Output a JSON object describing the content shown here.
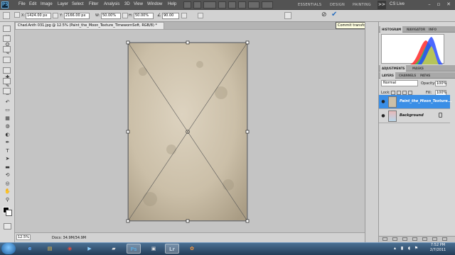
{
  "app": {
    "logo": "PS",
    "menu": [
      "File",
      "Edit",
      "Image",
      "Layer",
      "Select",
      "Filter",
      "Analysis",
      "3D",
      "View",
      "Window",
      "Help"
    ],
    "workspaces": [
      "ESSENTIALS",
      "DESIGN",
      "PAINTING"
    ],
    "more_label": ">>",
    "cslive": "CS Live",
    "window_controls": [
      "–",
      "▫",
      "✕"
    ]
  },
  "options": {
    "x_label": "X:",
    "x_value": "1424.00 px",
    "y_label": "Y:",
    "y_value": "2166.00 px",
    "w_label": "W:",
    "w_value": "50.00%",
    "h_label": "H:",
    "h_value": "50.00%",
    "angle_value": "90.00",
    "cancel_icon": "⊘",
    "commit_icon": "✔",
    "commit_tooltip": "Commit transform (Return)"
  },
  "document": {
    "tab_title": "Chad.Anth 031.jpg @ 12.5% (Paint_the_Moon_Texture_TimewornSoft, RGB/8) *",
    "zoom": "12.5%",
    "doc_info": "Docs: 34.9M/34.9M"
  },
  "panels": {
    "top_tabs": [
      "HISTOGRAM",
      "NAVIGATOR",
      "INFO"
    ],
    "mid_tabs": [
      "ADJUSTMENTS",
      "MASKS"
    ],
    "layer_tabs": [
      "LAYERS",
      "CHANNELS",
      "PATHS"
    ],
    "blend_mode": "Normal",
    "opacity_label": "Opacity:",
    "opacity_value": "100%",
    "lock_label": "Lock:",
    "fill_label": "Fill:",
    "fill_value": "100%",
    "layers": [
      {
        "name": "Paint_the_Moon_Texture...",
        "selected": true
      },
      {
        "name": "Background",
        "selected": false
      }
    ]
  },
  "taskbar": {
    "time": "7:52 PM",
    "date": "2/7/2011",
    "apps": [
      "ie",
      "explorer",
      "chrome",
      "media-player",
      "app",
      "ps",
      "app",
      "lr",
      "picasa"
    ]
  },
  "colors": {
    "accent": "#3a8ee6",
    "app_bar": "#535353",
    "selected_layer": "#3a8ee6"
  }
}
